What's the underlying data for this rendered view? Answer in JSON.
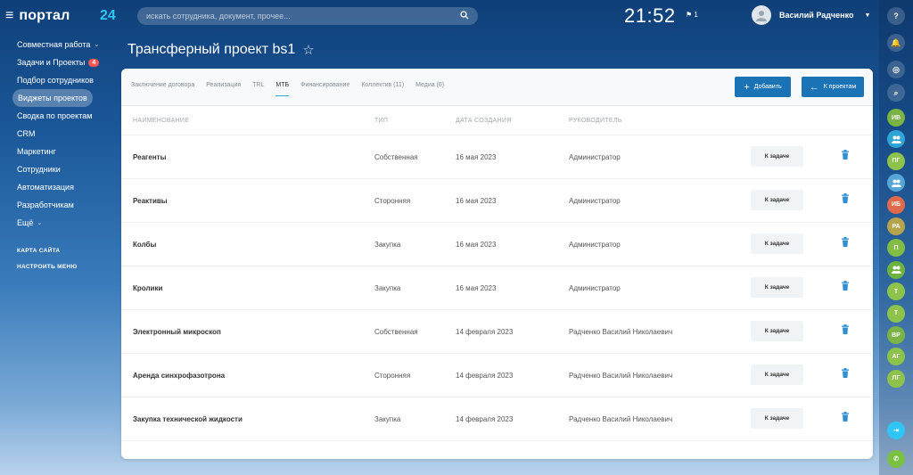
{
  "header": {
    "logo_text": "портал",
    "logo_number": "24",
    "search_placeholder": "искать сотрудника, документ, прочее...",
    "clock": "21:52",
    "flag_count": "1",
    "user_name": "Василий Радченко"
  },
  "sidebar": {
    "items": [
      {
        "label": "Совместная работа",
        "chevron": "⌄"
      },
      {
        "label": "Задачи и Проекты",
        "badge": "4"
      },
      {
        "label": "Подбор сотрудников"
      },
      {
        "label": "Виджеты проектов"
      },
      {
        "label": "Сводка по проектам"
      },
      {
        "label": "CRM"
      },
      {
        "label": "Маркетинг"
      },
      {
        "label": "Сотрудники"
      },
      {
        "label": "Автоматизация"
      },
      {
        "label": "Разработчикам"
      },
      {
        "label": "Ещё",
        "chevron": "⌄"
      }
    ],
    "footer": [
      "КАРТА САЙТА",
      "НАСТРОИТЬ МЕНЮ"
    ]
  },
  "page": {
    "title": "Трансферный проект bs1"
  },
  "tabs": [
    {
      "label": "Заключение договора"
    },
    {
      "label": "Реализация"
    },
    {
      "label": "TRL"
    },
    {
      "label": "МТБ"
    },
    {
      "label": "Финансирование"
    },
    {
      "label": "Коллектив (11)"
    },
    {
      "label": "Медиа (6)"
    }
  ],
  "toolbar": {
    "add_label": "Добавить",
    "back_label": "К проектам"
  },
  "table": {
    "headers": {
      "name": "НАИМЕНОВАНИЕ",
      "type": "ТИП",
      "date": "ДАТА СОЗДАНИЯ",
      "manager": "РУКОВОДИТЕЛЬ"
    },
    "task_button_label": "К задаче",
    "rows": [
      {
        "name": "Реагенты",
        "type": "Собственная",
        "date": "16 мая 2023",
        "manager": "Администратор"
      },
      {
        "name": "Реактивы",
        "type": "Сторонняя",
        "date": "16 мая 2023",
        "manager": "Администратор"
      },
      {
        "name": "Колбы",
        "type": "Закупка",
        "date": "16 мая 2023",
        "manager": "Администратор"
      },
      {
        "name": "Кролики",
        "type": "Закупка",
        "date": "16 мая 2023",
        "manager": "Администратор"
      },
      {
        "name": "Электронный микроскоп",
        "type": "Собственная",
        "date": "14 февраля 2023",
        "manager": "Радченко Василий Николаевич"
      },
      {
        "name": "Аренда синхрофазотрона",
        "type": "Сторонняя",
        "date": "14 февраля 2023",
        "manager": "Радченко Василий Николаевич"
      },
      {
        "name": "Закупка технической жидкости",
        "type": "Закупка",
        "date": "14 февраля 2023",
        "manager": "Радченко Василий Николаевич"
      }
    ]
  },
  "rightbar": {
    "top_icons": [
      "help-icon",
      "bell-icon",
      "chat-icon",
      "search-icon"
    ],
    "contacts": [
      {
        "initials": "ИВ",
        "color": "#7bb344"
      },
      {
        "initials": "",
        "icon": "group-chat-icon",
        "color": "#2fa4d6"
      },
      {
        "initials": "ПГ",
        "color": "#8ec34b"
      },
      {
        "initials": "",
        "icon": "group-icon",
        "color": "#55a6d9"
      },
      {
        "initials": "ИБ",
        "color": "#e06a4b"
      },
      {
        "initials": "РА",
        "color": "#b7a24e"
      },
      {
        "initials": "П",
        "color": "#82bd45"
      },
      {
        "initials": "",
        "icon": "group-icon",
        "color": "#6db33f"
      },
      {
        "initials": "Т",
        "color": "#8ec34b"
      },
      {
        "initials": "Т",
        "color": "#8ec34b"
      },
      {
        "initials": "ВР",
        "color": "#7bb344"
      },
      {
        "initials": "АГ",
        "color": "#8ec34b"
      },
      {
        "initials": "ЛГ",
        "color": "#8ec34b"
      }
    ],
    "bottom_icons": [
      "open-line-icon",
      "phone-icon"
    ]
  },
  "colors": {
    "accent": "#1a73b5",
    "badge": "#ff5752",
    "logo_number": "#2fc6f6"
  }
}
